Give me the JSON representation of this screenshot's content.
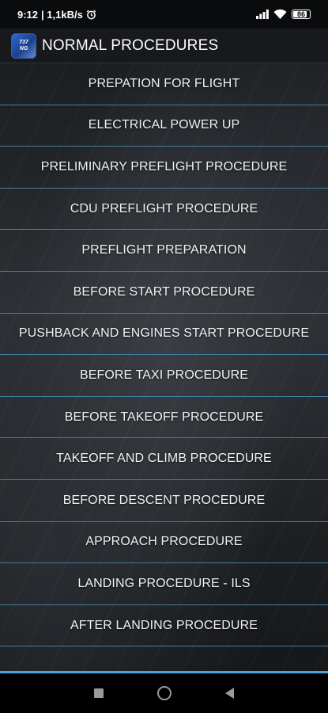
{
  "status_bar": {
    "time": "9:12",
    "network_speed": "| 1,1kB/s",
    "battery_level": "86",
    "icons": [
      "alarm-icon",
      "signal-icon",
      "wifi-icon",
      "battery-icon"
    ]
  },
  "app_bar": {
    "icon_text_top": "737",
    "icon_text_bottom": "NG",
    "title": "NORMAL PROCEDURES"
  },
  "procedures": [
    "PREPATION FOR FLIGHT",
    "ELECTRICAL POWER UP",
    "PRELIMINARY PREFLIGHT PROCEDURE",
    "CDU PREFLIGHT PROCEDURE",
    "PREFLIGHT PREPARATION",
    "BEFORE START PROCEDURE",
    "PUSHBACK AND ENGINES START PROCEDURE",
    "BEFORE TAXI PROCEDURE",
    "BEFORE TAKEOFF PROCEDURE",
    "TAKEOFF AND CLIMB PROCEDURE",
    "BEFORE DESCENT PROCEDURE",
    "APPROACH PROCEDURE",
    "LANDING PROCEDURE - ILS",
    "AFTER LANDING PROCEDURE"
  ],
  "colors": {
    "divider": "#3f7fa6",
    "accent_line": "#4aa3dc",
    "app_bar_bg": "#17191d"
  },
  "nav_bar": {
    "icons": [
      "recents-square-icon",
      "home-circle-icon",
      "back-triangle-icon"
    ]
  }
}
